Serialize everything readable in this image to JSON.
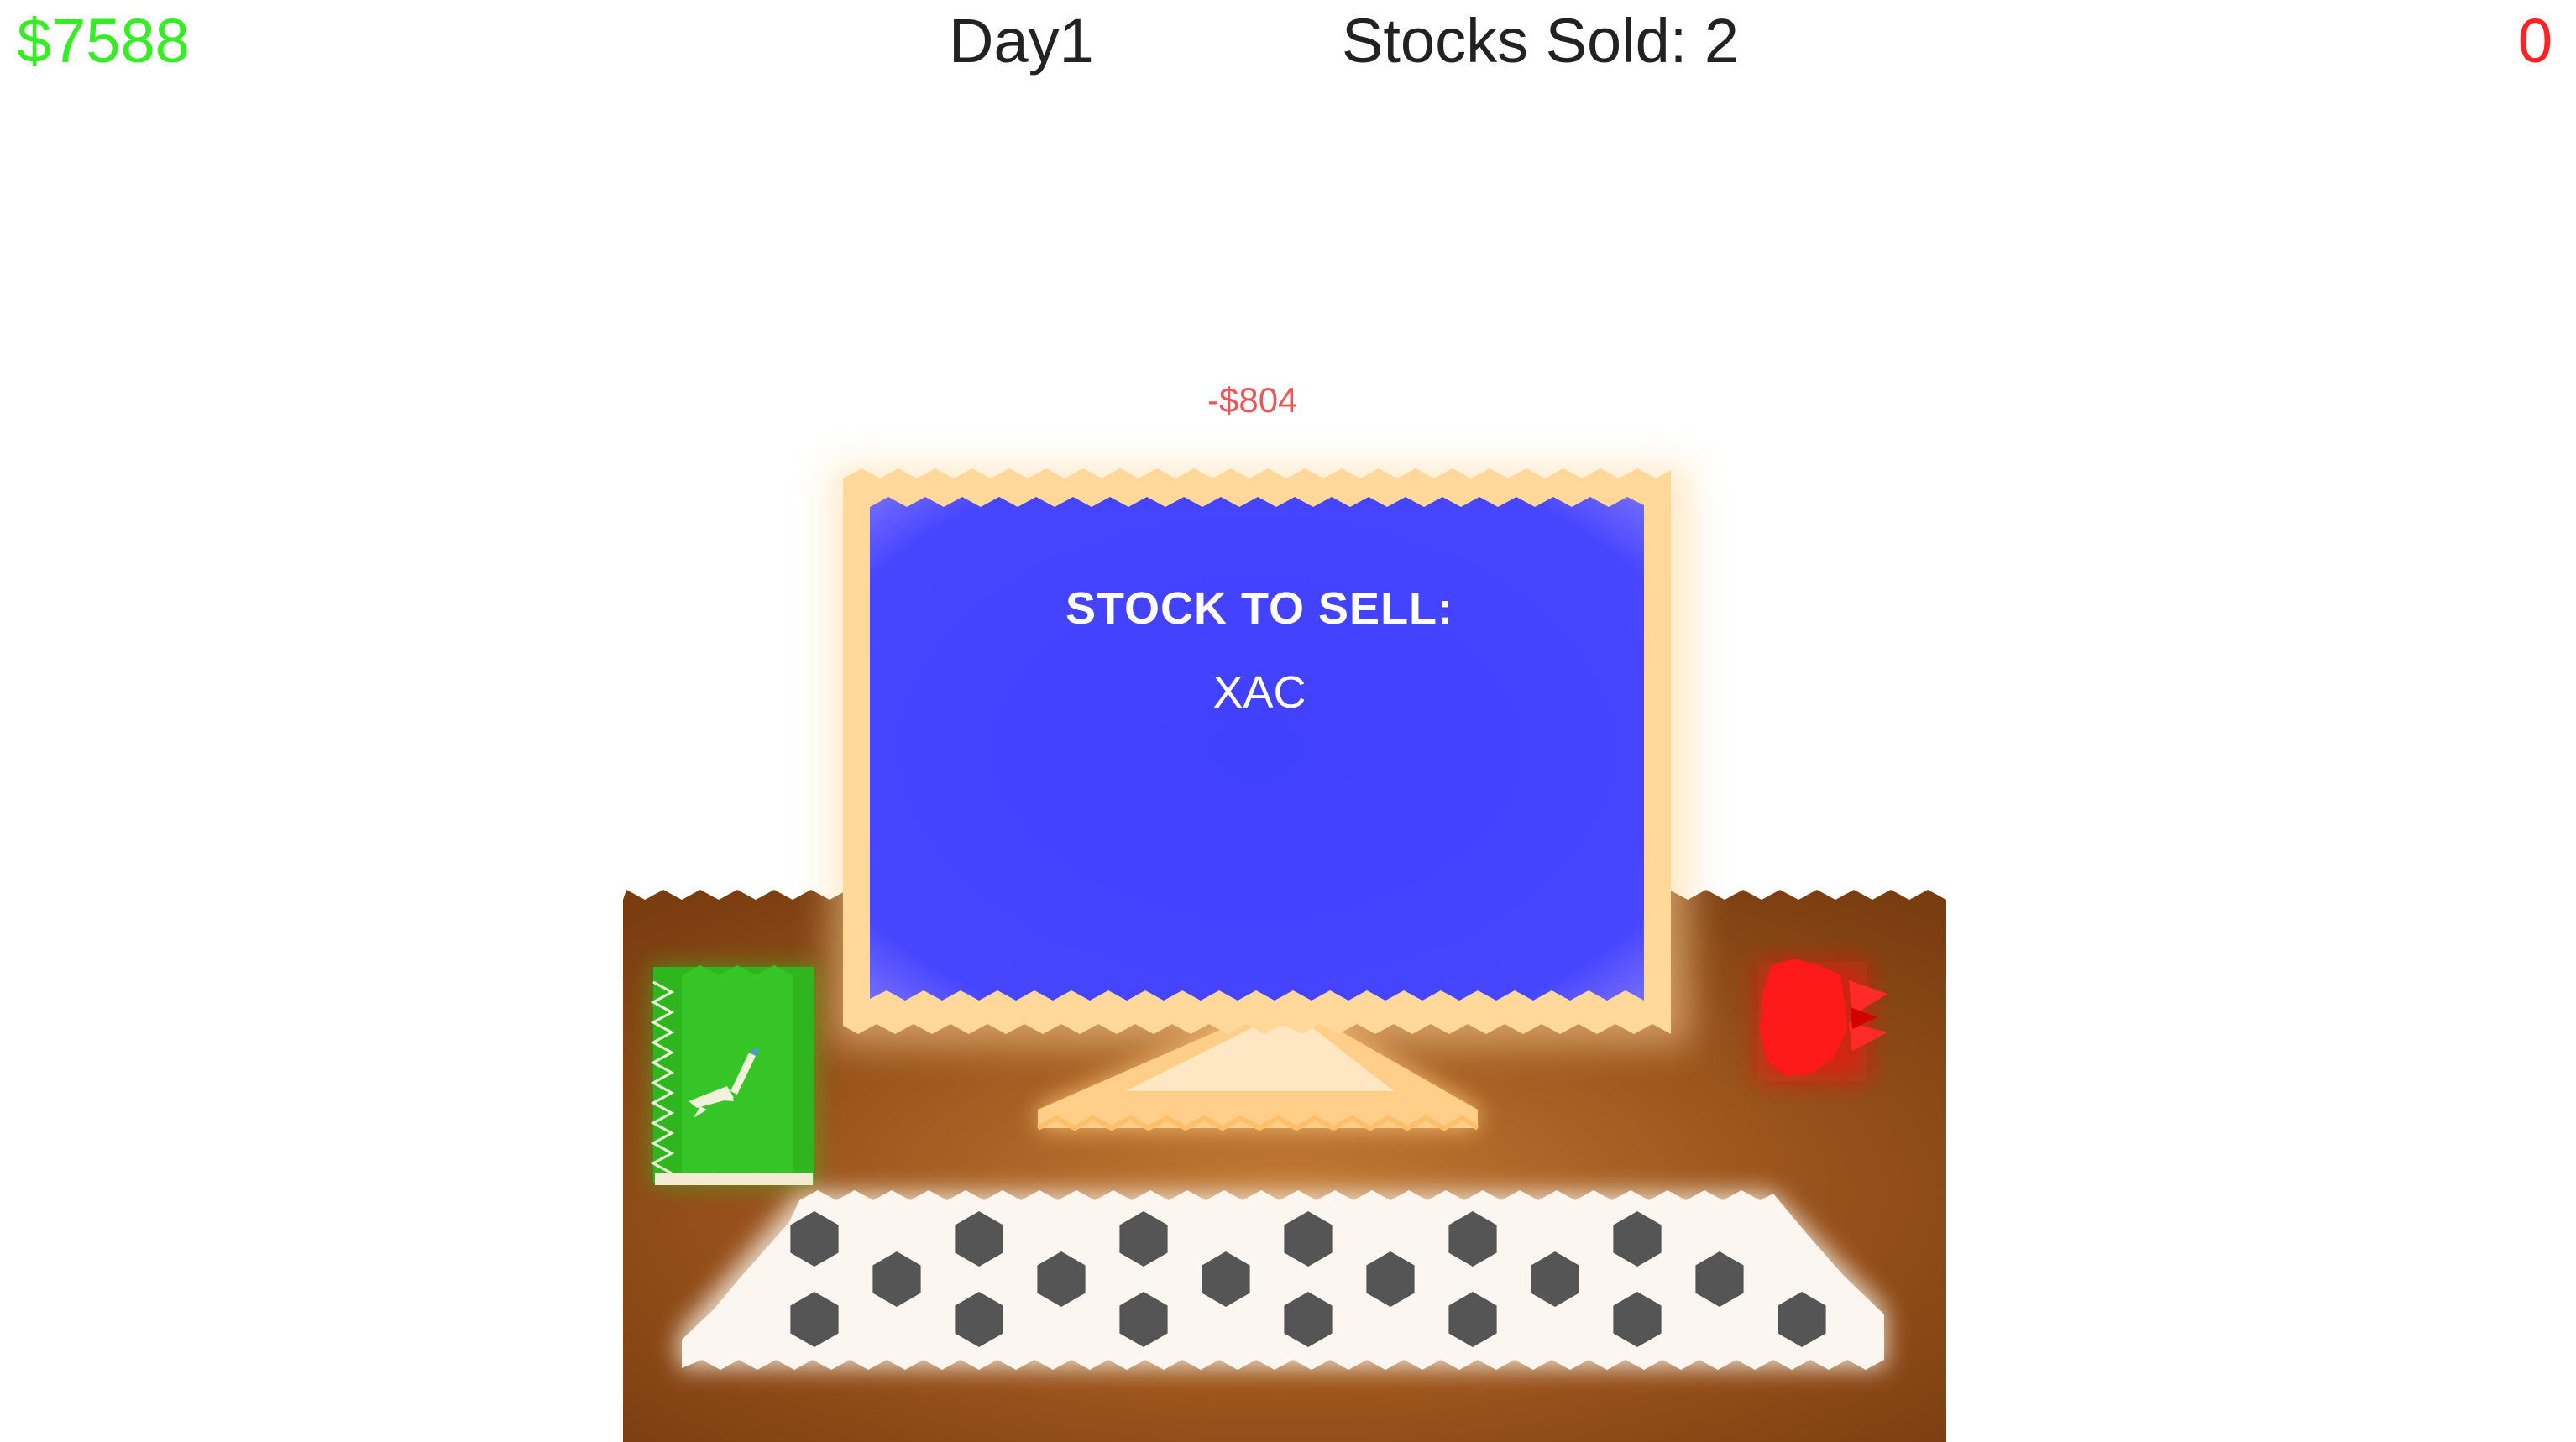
{
  "hud": {
    "money": "$7588",
    "day": "Day1",
    "stocks_sold": "Stocks Sold: 2",
    "counter": "0"
  },
  "popup": {
    "delta": "-$804"
  },
  "monitor": {
    "title": "STOCK TO SELL:",
    "symbol": "XAC"
  },
  "colors": {
    "money": "#33ee22",
    "counter": "#ff2222",
    "hud_text": "#222222",
    "delta": "#ee5555",
    "desk": "#8b4513",
    "screen": "#4444ff",
    "bezel": "#ffd89a",
    "book": "#22bb22",
    "red_object": "#ff1a1a",
    "keyboard": "#f8f2ea",
    "keys": "#555555"
  },
  "icons": {
    "book_symbol": "rocket-icon",
    "red_object": "stop-alarm-icon"
  }
}
